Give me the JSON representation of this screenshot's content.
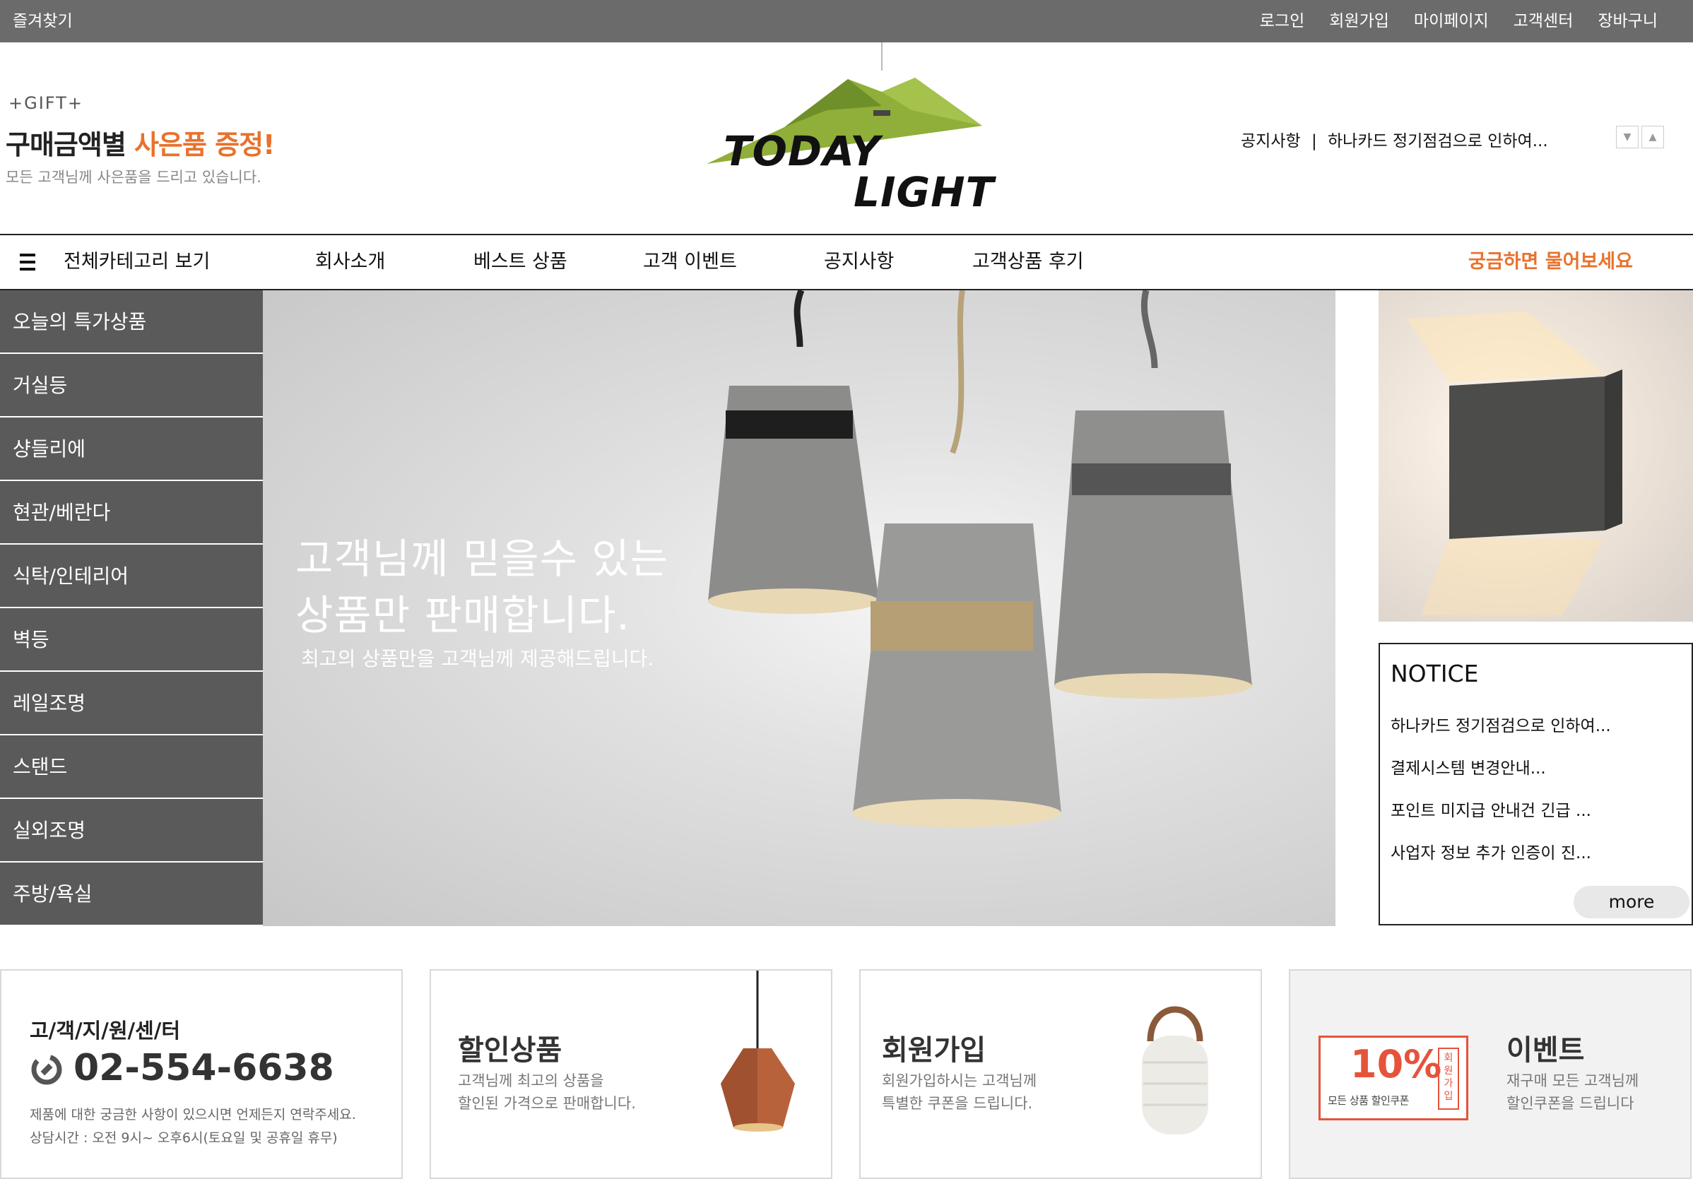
{
  "topbar": {
    "favorite": "즐겨찾기",
    "links": [
      "로그인",
      "회원가입",
      "마이페이지",
      "고객센터",
      "장바구니"
    ]
  },
  "gift": {
    "tag": "+GIFT+",
    "main_prefix": "구매금액별 ",
    "main_highlight": "사은품 증정!",
    "sub": "모든 고객님께 사은품을 드리고 있습니다."
  },
  "logo": {
    "line1": "TODAY",
    "line2": "LIGHT"
  },
  "header_notice": {
    "label": "공지사항",
    "separator": "|",
    "text": "하나카드 정기점검으로 인하여..."
  },
  "nav": {
    "all_categories": "전체카테고리 보기",
    "items": [
      "회사소개",
      "베스트 상품",
      "고객 이벤트",
      "공지사항",
      "고객상품 후기"
    ],
    "ask": "궁금하면 물어보세요"
  },
  "sidebar": {
    "categories": [
      "오늘의 특가상품",
      "거실등",
      "샹들리에",
      "현관/베란다",
      "식탁/인테리어",
      "벽등",
      "레일조명",
      "스탠드",
      "실외조명",
      "주방/욕실"
    ]
  },
  "hero": {
    "line1": "고객님께 믿을수 있는",
    "line2": "상품만 판매합니다.",
    "sub": "최고의 상품만을 고객님께 제공해드립니다."
  },
  "notice": {
    "title": "NOTICE",
    "items": [
      "하나카드 정기점검으로 인하여...",
      "결제시스템 변경안내...",
      "포인트 미지급 안내건 긴급 ...",
      "사업자 정보 추가 인증이 진..."
    ],
    "more": "more"
  },
  "banners": {
    "cs": {
      "label": "고/객/지/원/센/터",
      "phone": "02-554-6638",
      "desc1": "제품에 대한 궁금한 사항이 있으시면 언제든지 연락주세요.",
      "desc2": "상담시간 : 오전 9시~ 오후6시(토요일 및 공휴일 휴무)"
    },
    "sale": {
      "title": "할인상품",
      "desc1": "고객님께 최고의 상품을",
      "desc2": "할인된 가격으로 판매합니다."
    },
    "join": {
      "title": "회원가입",
      "desc1": "회원가입하시는 고객님께",
      "desc2": "특별한 쿠폰을 드립니다."
    },
    "event": {
      "title": "이벤트",
      "desc1": "재구매 모든 고객님께",
      "desc2": "할인쿠폰을 드립니다",
      "coupon_percent": "10%",
      "coupon_caption": "모든 상품 할인쿠폰",
      "coupon_side": "회원가입"
    }
  },
  "colors": {
    "topbar": "#6b6b6b",
    "sidebar": "#5a5a5a",
    "accent": "#e8722c",
    "coupon": "#e5533b",
    "logo_green": "#8fae3a"
  },
  "icons": {
    "menu": "hamburger-icon",
    "up": "chevron-up-icon",
    "down": "chevron-down-icon",
    "phone": "phone-icon"
  }
}
